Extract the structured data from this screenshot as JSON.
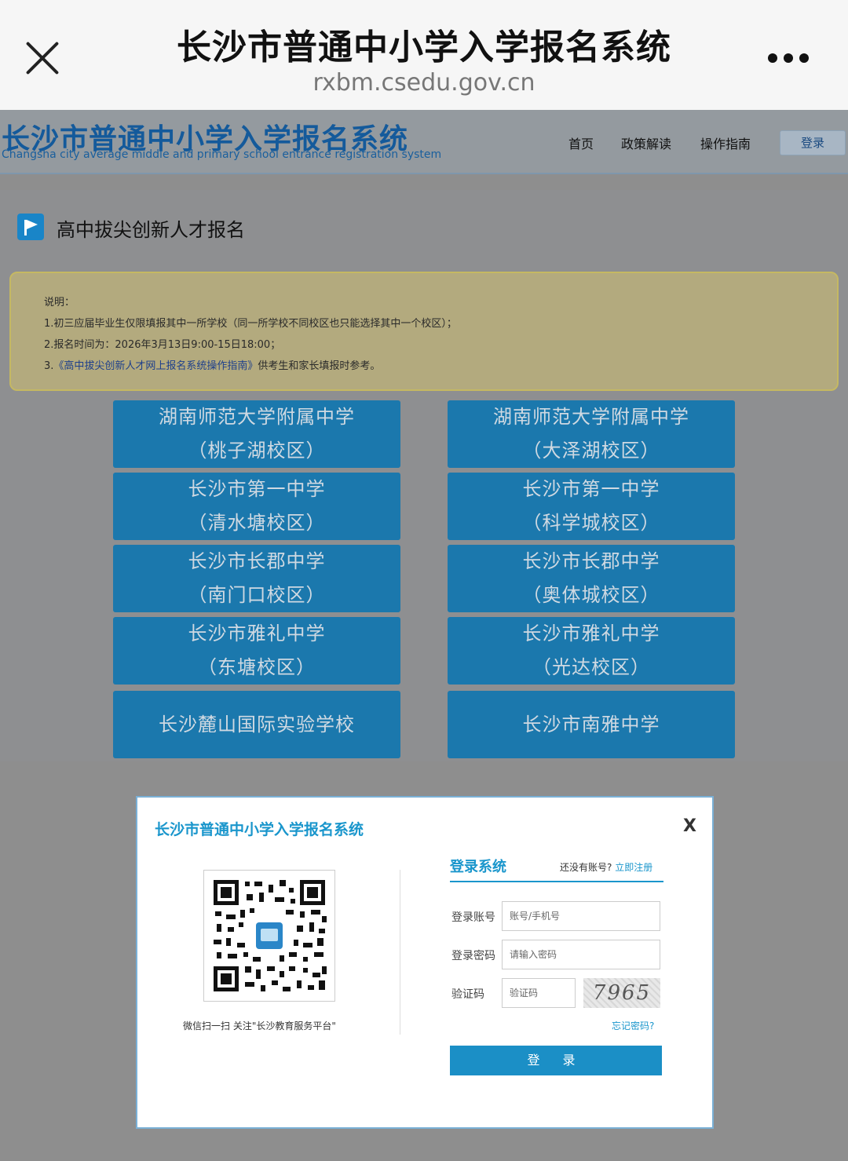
{
  "browser": {
    "title": "长沙市普通中小学入学报名系统",
    "url": "rxbm.csedu.gov.cn"
  },
  "site": {
    "logo_cn": "长沙市普通中小学入学报名系统",
    "logo_en": "Changsha city average middle and primary school entrance registration system",
    "nav": [
      "首页",
      "政策解读",
      "操作指南"
    ],
    "login_button": "登录"
  },
  "section": {
    "title": "高中拔尖创新人才报名"
  },
  "notice": {
    "heading": "说明：",
    "line1": "1.初三应届毕业生仅限填报其中一所学校（同一所学校不同校区也只能选择其中一个校区）；",
    "line2": "2.报名时间为：2026年3月13日9:00-15日18:00；",
    "line3_prefix": "3.",
    "line3_link": "《高中拔尖创新人才网上报名系统操作指南》",
    "line3_suffix": "供考生和家长填报时参考。"
  },
  "schools": [
    {
      "name": "湖南师范大学附属中学",
      "campus": "（桃子湖校区）"
    },
    {
      "name": "湖南师范大学附属中学",
      "campus": "（大泽湖校区）"
    },
    {
      "name": "长沙市第一中学",
      "campus": "（清水塘校区）"
    },
    {
      "name": "长沙市第一中学",
      "campus": "（科学城校区）"
    },
    {
      "name": "长沙市长郡中学",
      "campus": "（南门口校区）"
    },
    {
      "name": "长沙市长郡中学",
      "campus": "（奥体城校区）"
    },
    {
      "name": "长沙市雅礼中学",
      "campus": "（东塘校区）"
    },
    {
      "name": "长沙市雅礼中学",
      "campus": "（光达校区）"
    },
    {
      "name": "长沙麓山国际实验学校",
      "campus": ""
    },
    {
      "name": "长沙市南雅中学",
      "campus": ""
    }
  ],
  "modal": {
    "title": "长沙市普通中小学入学报名系统",
    "close": "X",
    "qr_caption": "微信扫一扫   关注\"长沙教育服务平台\"",
    "login_title": "登录系统",
    "no_account": "还没有账号?",
    "register": "立即注册",
    "account_label": "登录账号",
    "account_placeholder": "账号/手机号",
    "password_label": "登录密码",
    "password_placeholder": "请输入密码",
    "captcha_label": "验证码",
    "captcha_placeholder": "验证码",
    "captcha_text": "7965",
    "forgot": "忘记密码?",
    "login_button": "登 录"
  },
  "colors": {
    "brand_blue": "#1b78ad",
    "accent": "#1a96cc",
    "notice_bg": "#b3aa7e"
  }
}
